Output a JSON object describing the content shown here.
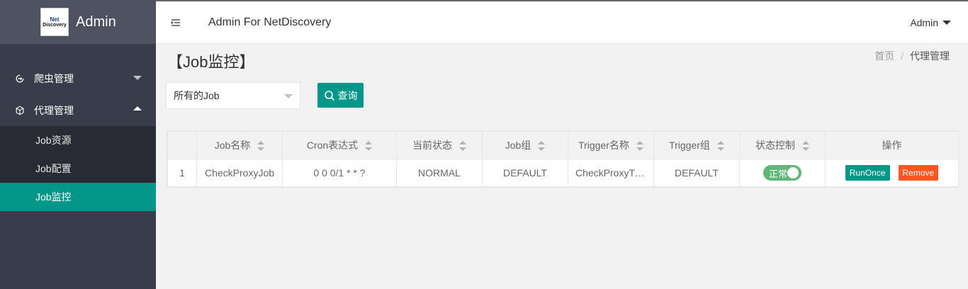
{
  "brand": {
    "title": "Admin",
    "logo_line1": "Net",
    "logo_line2": "Discovery"
  },
  "header": {
    "title": "Admin For NetDiscovery",
    "user": "Admin"
  },
  "sidebar": {
    "groups": [
      {
        "label": "爬虫管理",
        "expanded": false
      },
      {
        "label": "代理管理",
        "expanded": true,
        "items": [
          {
            "label": "Job资源",
            "active": false
          },
          {
            "label": "Job配置",
            "active": false
          },
          {
            "label": "Job监控",
            "active": true
          }
        ]
      }
    ]
  },
  "page": {
    "title": "【Job监控】",
    "breadcrumb": {
      "home": "首页",
      "sep": "/",
      "current": "代理管理"
    },
    "filter": {
      "selected": "所有的Job",
      "query_label": "查询"
    }
  },
  "table": {
    "headers": [
      "",
      "Job名称",
      "Cron表达式",
      "当前状态",
      "Job组",
      "Trigger名称",
      "Trigger组",
      "状态控制",
      "操作"
    ],
    "rows": [
      {
        "index": "1",
        "job_name": "CheckProxyJob",
        "cron": "0 0 0/1 * * ?",
        "state": "NORMAL",
        "job_group": "DEFAULT",
        "trigger_name": "CheckProxyTrigger",
        "trigger_group": "DEFAULT",
        "switch_label": "正常",
        "run_label": "RunOnce",
        "remove_label": "Remove"
      }
    ]
  },
  "colors": {
    "sidebar": "#393d49",
    "brand_bg": "#4d5160",
    "accent": "#009688",
    "switch_on": "#5fb878",
    "danger": "#ff5722"
  }
}
